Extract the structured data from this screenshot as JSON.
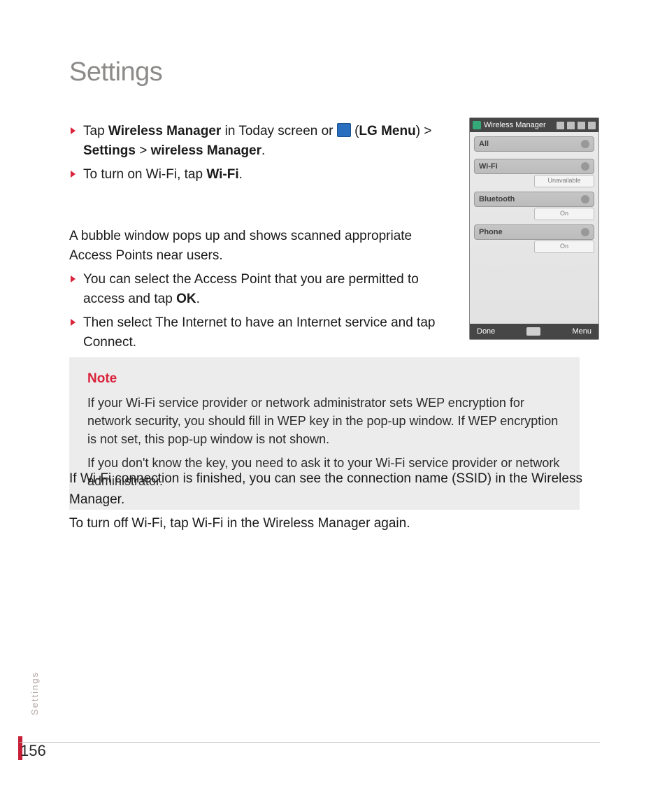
{
  "title": "Settings",
  "bullet1": {
    "pre": "Tap ",
    "b1": "Wireless Manager",
    "mid1": " in Today screen or ",
    "paren_open": "(",
    "b2": "LG Menu",
    "paren_close": ") > ",
    "b3": "Settings",
    "gt": " > ",
    "b4": "wireless Manager",
    "end": "."
  },
  "bullet2": {
    "pre": "To turn on Wi-Fi, tap ",
    "b": "Wi-Fi",
    "end": "."
  },
  "para1": "A bubble window pops up and shows scanned appropriate  Access Points near users.",
  "bullet3": {
    "pre": "You can select the Access Point that you are permitted to access and tap ",
    "b": "OK",
    "end": "."
  },
  "bullet4": "Then select The Internet to have an Internet service and tap Connect.",
  "note": {
    "title": "Note",
    "p1": "If your Wi-Fi service provider or network administrator sets WEP encryption for network security, you should fill in WEP key in the pop-up window. If WEP encryption is not set, this pop-up window is not shown.",
    "p2": "If you don't know the key, you need to ask it to your Wi-Fi service provider or network administrator."
  },
  "after": {
    "p1": "If  Wi-Fi connection is finished, you can see the connection name (SSID) in the  Wireless Manager.",
    "p2": "To turn off Wi-Fi, tap Wi-Fi in the Wireless Manager again."
  },
  "side_label": "Settings",
  "page_number": "156",
  "phone": {
    "title": "Wireless Manager",
    "rows": {
      "all": "All",
      "wifi": "Wi-Fi",
      "wifi_status": "Unavailable",
      "bluetooth": "Bluetooth",
      "bluetooth_status": "On",
      "phone": "Phone",
      "phone_status": "On"
    },
    "bottom": {
      "done": "Done",
      "menu": "Menu"
    }
  }
}
